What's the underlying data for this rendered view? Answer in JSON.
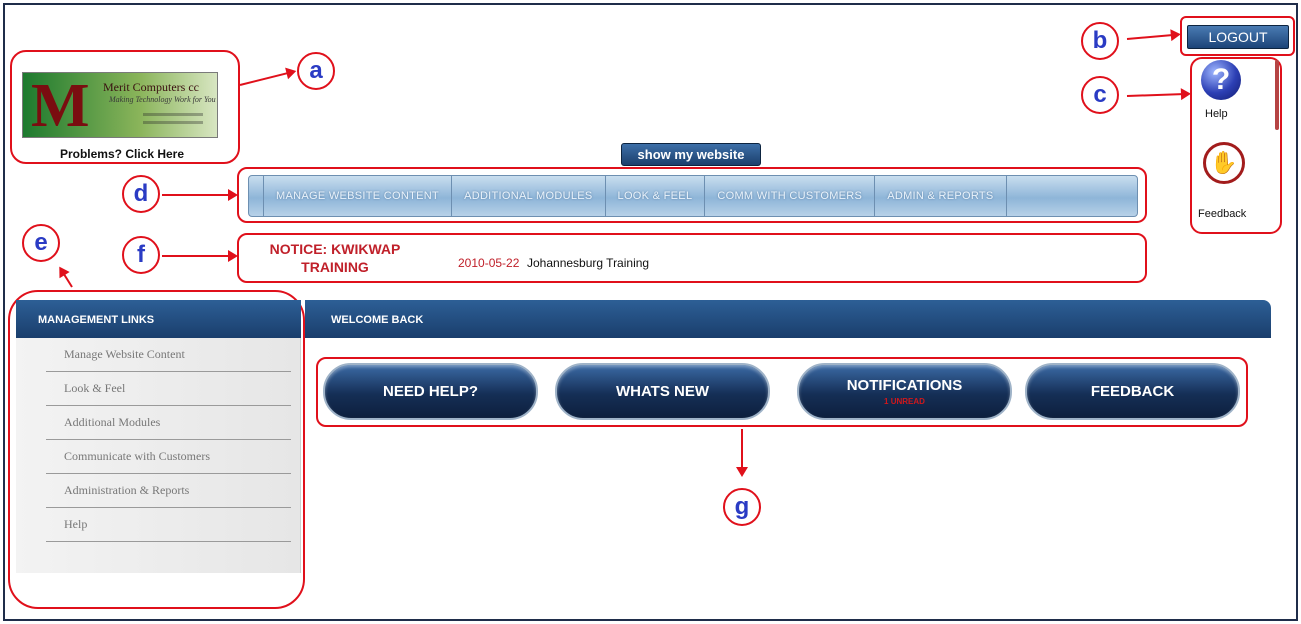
{
  "callouts": [
    "a",
    "b",
    "c",
    "d",
    "e",
    "f",
    "g"
  ],
  "logo": {
    "letter": "M",
    "name": "Merit Computers cc",
    "tagline": "Making Technology Work for You"
  },
  "problems_link": "Problems? Click Here",
  "logout_label": "LOGOUT",
  "show_website_label": "show my website",
  "side_icons": {
    "help_label": "Help",
    "feedback_label": "Feedback"
  },
  "top_nav": [
    "MANAGE WEBSITE CONTENT",
    "ADDITIONAL MODULES",
    "LOOK & FEEL",
    "COMM WITH CUSTOMERS",
    "ADMIN & REPORTS"
  ],
  "notice": {
    "title": "NOTICE: KWIKWAP TRAINING",
    "date": "2010-05-22",
    "text": "Johannesburg Training"
  },
  "management_links": {
    "heading": "MANAGEMENT LINKS",
    "items": [
      "Manage Website Content",
      "Look & Feel",
      "Additional Modules",
      "Communicate with Customers",
      "Administration & Reports",
      "Help"
    ]
  },
  "main": {
    "heading": "WELCOME BACK",
    "buttons": [
      "NEED HELP?",
      "WHATS NEW",
      "NOTIFICATIONS",
      "FEEDBACK"
    ],
    "notifications_sub": "1 UNREAD"
  },
  "colors": {
    "callout": "#e0101b",
    "callout_text": "#2a3bc4",
    "header_blue": "#1a3e6c",
    "notice_red": "#c0202a"
  }
}
